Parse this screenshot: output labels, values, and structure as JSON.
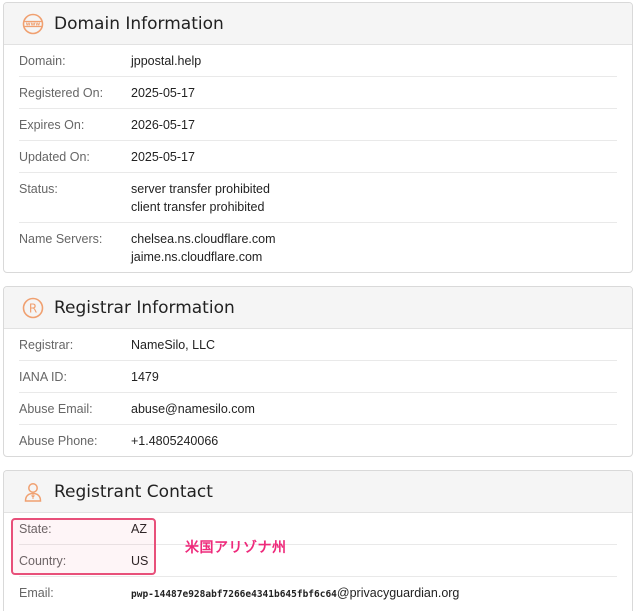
{
  "domain_info": {
    "title": "Domain Information",
    "icon": "www-globe-icon",
    "rows": [
      {
        "label": "Domain:",
        "values": [
          "jppostal.help"
        ]
      },
      {
        "label": "Registered On:",
        "values": [
          "2025-05-17"
        ]
      },
      {
        "label": "Expires On:",
        "values": [
          "2026-05-17"
        ]
      },
      {
        "label": "Updated On:",
        "values": [
          "2025-05-17"
        ]
      },
      {
        "label": "Status:",
        "values": [
          "server transfer prohibited",
          "client transfer prohibited"
        ]
      },
      {
        "label": "Name Servers:",
        "values": [
          "chelsea.ns.cloudflare.com",
          "jaime.ns.cloudflare.com"
        ]
      }
    ]
  },
  "registrar_info": {
    "title": "Registrar Information",
    "icon": "registered-icon",
    "rows": [
      {
        "label": "Registrar:",
        "values": [
          "NameSilo, LLC"
        ]
      },
      {
        "label": "IANA ID:",
        "values": [
          "1479"
        ]
      },
      {
        "label": "Abuse Email:",
        "values": [
          "abuse@namesilo.com"
        ]
      },
      {
        "label": "Abuse Phone:",
        "values": [
          "+1.4805240066"
        ]
      }
    ]
  },
  "registrant_contact": {
    "title": "Registrant Contact",
    "icon": "person-icon",
    "rows": [
      {
        "label": "State:",
        "values": [
          "AZ"
        ]
      },
      {
        "label": "Country:",
        "values": [
          "US"
        ]
      }
    ],
    "email": {
      "label": "Email:",
      "code": "pwp-14487e928abf7266e4341b645fbf6c64",
      "domain": "@privacyguardian.org"
    }
  },
  "annotation": {
    "text": "米国アリゾナ州"
  },
  "colors": {
    "accent_orange": "#f0a070",
    "annotation_pink": "#ee2a7b",
    "highlight_border": "#e8507a"
  }
}
